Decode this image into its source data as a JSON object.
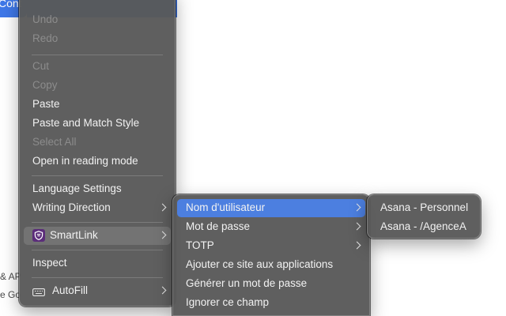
{
  "background": {
    "button_label": "Cont",
    "line1": "& AP",
    "line2": "e Go"
  },
  "main_menu": {
    "undo": "Undo",
    "redo": "Redo",
    "cut": "Cut",
    "copy": "Copy",
    "paste": "Paste",
    "paste_match": "Paste and Match Style",
    "select_all": "Select All",
    "reading_mode": "Open in reading mode",
    "language_settings": "Language Settings",
    "writing_direction": "Writing Direction",
    "smartlink": "SmartLink",
    "inspect": "Inspect",
    "autofill": "AutoFill"
  },
  "smartlink_menu": {
    "username": "Nom d'utilisateur",
    "password": "Mot de passe",
    "totp": "TOTP",
    "add_site": "Ajouter ce site aux applications",
    "generate_password": "Générer un mot de passe",
    "ignore_field": "Ignorer ce champ"
  },
  "username_menu": {
    "items": [
      "Asana - Personnel",
      "Asana - /AgenceA"
    ]
  },
  "colors": {
    "menu_bg": "#585858",
    "highlight": "#4c7fe0",
    "disabled_text": "#8c8c8c",
    "text": "#f2f2f2",
    "accent_button": "#3f78e8"
  },
  "icons": {
    "smartlink": "smartlink-shield-icon",
    "autofill": "autofill-keyboard-icon",
    "submenu": "chevron-right-icon"
  }
}
